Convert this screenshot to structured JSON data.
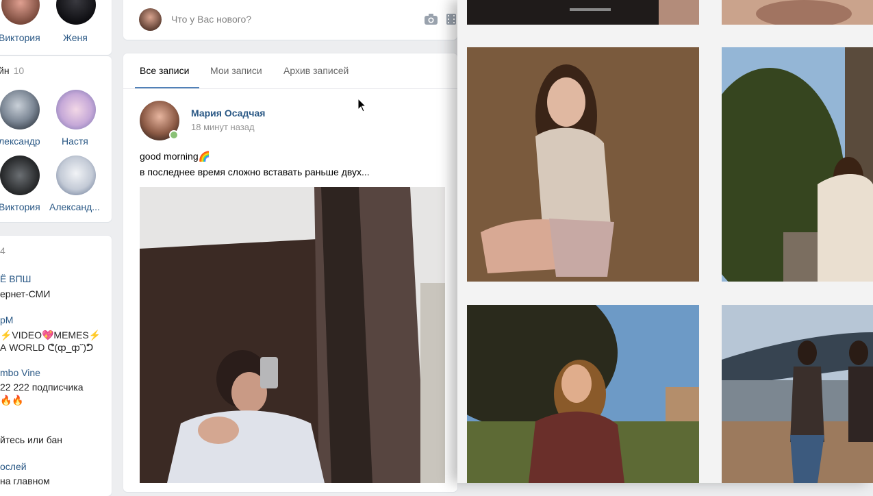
{
  "friends": [
    {
      "name": "Виктория"
    },
    {
      "name": "Женя"
    }
  ],
  "online": {
    "title": "йн",
    "count": "10",
    "people": [
      {
        "name": "лександр"
      },
      {
        "name": "Настя"
      },
      {
        "name": "Виктория"
      },
      {
        "name": "Александ..."
      }
    ]
  },
  "groups": {
    "count": "4",
    "items": [
      {
        "name": "Ё ВПШ",
        "sub": "ернет-СМИ"
      },
      {
        "name": "рМ",
        "sub": "⚡VIDEO💖MEMES⚡",
        "sub2": "А WORLD ᕦ(ȹ_ȹ˘)ᕤ"
      },
      {
        "name": "mbo Vine",
        "sub": "22 222 подписчика",
        "sub2": "🔥🔥"
      },
      {
        "name": "",
        "sub": "йтесь или бан"
      },
      {
        "name": "ослей",
        "sub": "на главном"
      }
    ]
  },
  "composer": {
    "placeholder": "Что у Вас нового?",
    "camera_icon": "camera-icon",
    "video_icon": "film-icon"
  },
  "wall": {
    "tabs": [
      {
        "label": "Все записи",
        "active": true
      },
      {
        "label": "Мои записи",
        "active": false
      },
      {
        "label": "Архив записей",
        "active": false
      }
    ]
  },
  "post": {
    "author": "Мария Осадчая",
    "time": "18 минут назад",
    "text_line1": "good morning🌈",
    "text_line2": "в последнее время сложно вставать раньше двух..."
  },
  "colors": {
    "link": "#2a5885",
    "accent": "#5181b8",
    "online_dot": "#8ac176",
    "background": "#edeef0"
  }
}
